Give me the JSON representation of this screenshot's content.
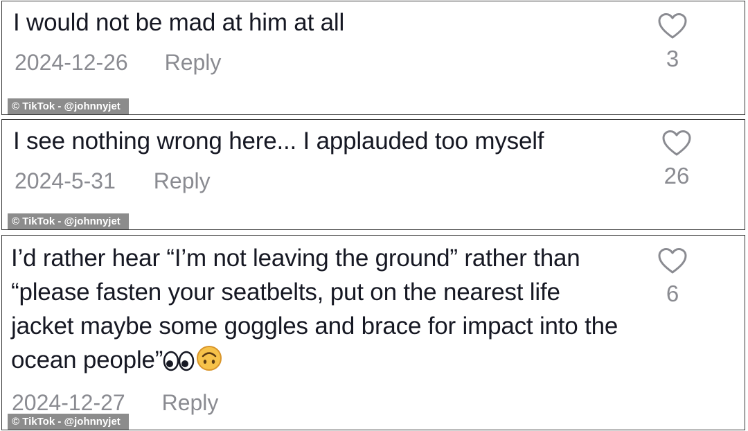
{
  "comments": [
    {
      "text": "I would not be mad at him at all",
      "date": "2024-12-26",
      "reply_label": "Reply",
      "likes": "3",
      "watermark": "© TikTok - @johnnyjet"
    },
    {
      "text": "I see nothing wrong here... I applauded too myself",
      "date": "2024-5-31",
      "reply_label": "Reply",
      "likes": "26",
      "watermark": "© TikTok - @johnnyjet"
    },
    {
      "text": "I’d rather hear “I’m not leaving the ground” rather than “please fasten your seatbelts, put on the nearest life jacket maybe some goggles and brace for impact into the ocean people”",
      "emojis": [
        "eyes-emoji",
        "upside-down-face-emoji"
      ],
      "date": "2024-12-27",
      "reply_label": "Reply",
      "likes": "6",
      "watermark": "© TikTok - @johnnyjet"
    }
  ],
  "icons": {
    "like": "heart-outline-icon"
  },
  "colors": {
    "text": "#161823",
    "meta": "#8a8b91",
    "border": "#333333",
    "watermark_bg": "#8c8c8c"
  }
}
